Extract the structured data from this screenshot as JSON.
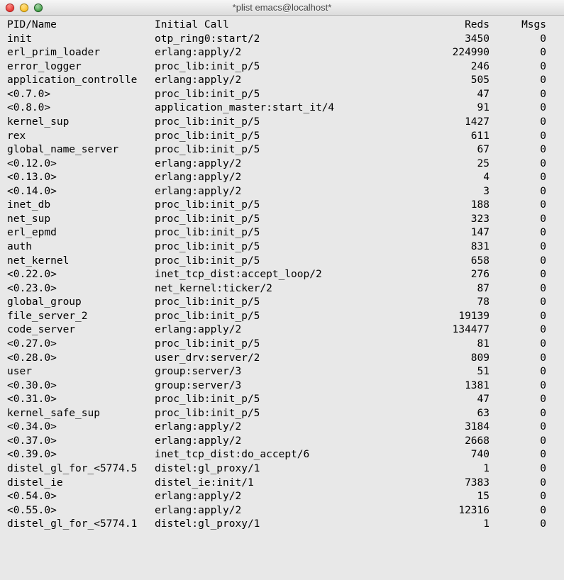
{
  "window": {
    "title": "*plist emacs@localhost*"
  },
  "headers": {
    "pid": "PID/Name",
    "call": "Initial Call",
    "reds": "Reds",
    "msgs": "Msgs"
  },
  "rows": [
    {
      "pid": "init",
      "call": "otp_ring0:start/2",
      "reds": "3450",
      "msgs": "0"
    },
    {
      "pid": "erl_prim_loader",
      "call": "erlang:apply/2",
      "reds": "224990",
      "msgs": "0"
    },
    {
      "pid": "error_logger",
      "call": "proc_lib:init_p/5",
      "reds": "246",
      "msgs": "0"
    },
    {
      "pid": "application_controlle",
      "call": "erlang:apply/2",
      "reds": "505",
      "msgs": "0"
    },
    {
      "pid": "<0.7.0>",
      "call": "proc_lib:init_p/5",
      "reds": "47",
      "msgs": "0"
    },
    {
      "pid": "<0.8.0>",
      "call": "application_master:start_it/4",
      "reds": "91",
      "msgs": "0"
    },
    {
      "pid": "kernel_sup",
      "call": "proc_lib:init_p/5",
      "reds": "1427",
      "msgs": "0"
    },
    {
      "pid": "rex",
      "call": "proc_lib:init_p/5",
      "reds": "611",
      "msgs": "0"
    },
    {
      "pid": "global_name_server",
      "call": "proc_lib:init_p/5",
      "reds": "67",
      "msgs": "0"
    },
    {
      "pid": "<0.12.0>",
      "call": "erlang:apply/2",
      "reds": "25",
      "msgs": "0"
    },
    {
      "pid": "<0.13.0>",
      "call": "erlang:apply/2",
      "reds": "4",
      "msgs": "0"
    },
    {
      "pid": "<0.14.0>",
      "call": "erlang:apply/2",
      "reds": "3",
      "msgs": "0"
    },
    {
      "pid": "inet_db",
      "call": "proc_lib:init_p/5",
      "reds": "188",
      "msgs": "0"
    },
    {
      "pid": "net_sup",
      "call": "proc_lib:init_p/5",
      "reds": "323",
      "msgs": "0"
    },
    {
      "pid": "erl_epmd",
      "call": "proc_lib:init_p/5",
      "reds": "147",
      "msgs": "0"
    },
    {
      "pid": "auth",
      "call": "proc_lib:init_p/5",
      "reds": "831",
      "msgs": "0"
    },
    {
      "pid": "net_kernel",
      "call": "proc_lib:init_p/5",
      "reds": "658",
      "msgs": "0"
    },
    {
      "pid": "<0.22.0>",
      "call": "inet_tcp_dist:accept_loop/2",
      "reds": "276",
      "msgs": "0"
    },
    {
      "pid": "<0.23.0>",
      "call": "net_kernel:ticker/2",
      "reds": "87",
      "msgs": "0"
    },
    {
      "pid": "global_group",
      "call": "proc_lib:init_p/5",
      "reds": "78",
      "msgs": "0"
    },
    {
      "pid": "file_server_2",
      "call": "proc_lib:init_p/5",
      "reds": "19139",
      "msgs": "0"
    },
    {
      "pid": "code_server",
      "call": "erlang:apply/2",
      "reds": "134477",
      "msgs": "0"
    },
    {
      "pid": "<0.27.0>",
      "call": "proc_lib:init_p/5",
      "reds": "81",
      "msgs": "0"
    },
    {
      "pid": "<0.28.0>",
      "call": "user_drv:server/2",
      "reds": "809",
      "msgs": "0"
    },
    {
      "pid": "user",
      "call": "group:server/3",
      "reds": "51",
      "msgs": "0"
    },
    {
      "pid": "<0.30.0>",
      "call": "group:server/3",
      "reds": "1381",
      "msgs": "0"
    },
    {
      "pid": "<0.31.0>",
      "call": "proc_lib:init_p/5",
      "reds": "47",
      "msgs": "0"
    },
    {
      "pid": "kernel_safe_sup",
      "call": "proc_lib:init_p/5",
      "reds": "63",
      "msgs": "0"
    },
    {
      "pid": "<0.34.0>",
      "call": "erlang:apply/2",
      "reds": "3184",
      "msgs": "0"
    },
    {
      "pid": "<0.37.0>",
      "call": "erlang:apply/2",
      "reds": "2668",
      "msgs": "0"
    },
    {
      "pid": "<0.39.0>",
      "call": "inet_tcp_dist:do_accept/6",
      "reds": "740",
      "msgs": "0"
    },
    {
      "pid": "distel_gl_for_<5774.5",
      "call": "distel:gl_proxy/1",
      "reds": "1",
      "msgs": "0"
    },
    {
      "pid": "distel_ie",
      "call": "distel_ie:init/1",
      "reds": "7383",
      "msgs": "0"
    },
    {
      "pid": "<0.54.0>",
      "call": "erlang:apply/2",
      "reds": "15",
      "msgs": "0"
    },
    {
      "pid": "<0.55.0>",
      "call": "erlang:apply/2",
      "reds": "12316",
      "msgs": "0"
    },
    {
      "pid": "distel_gl_for_<5774.1",
      "call": "distel:gl_proxy/1",
      "reds": "1",
      "msgs": "0"
    }
  ]
}
